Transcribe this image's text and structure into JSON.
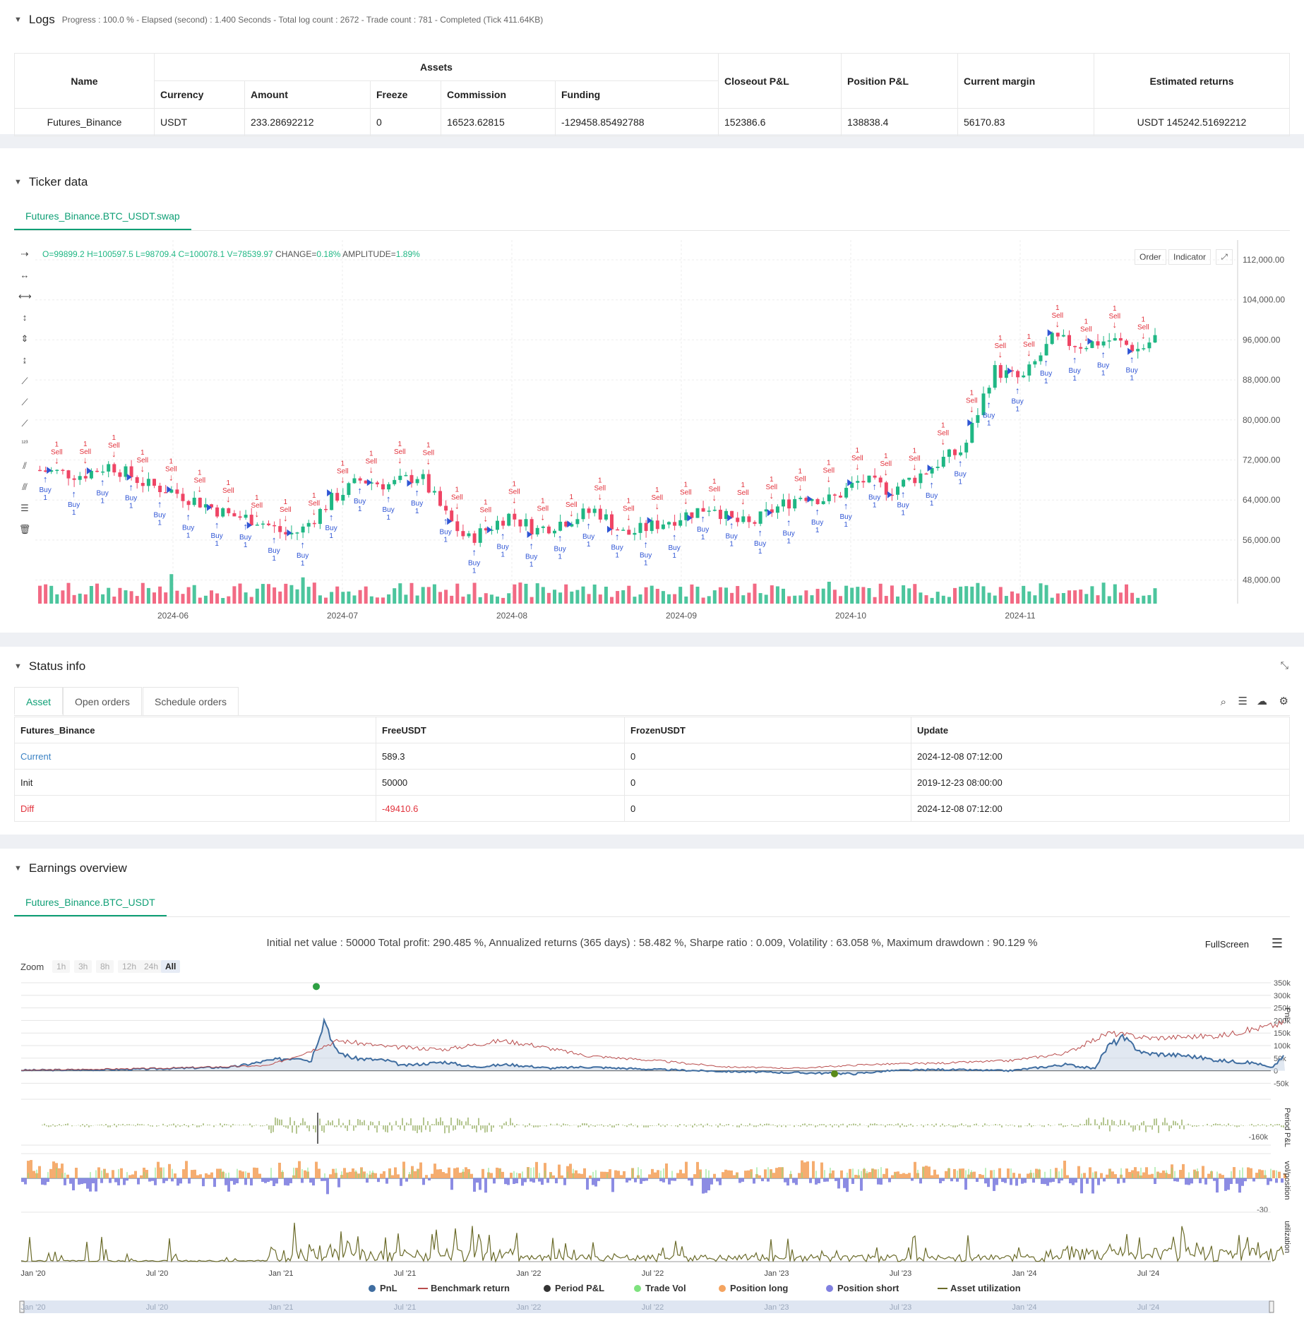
{
  "logs": {
    "title": "Logs",
    "summary": "Progress : 100.0 % - Elapsed (second) : 1.400 Seconds - Total log count : 2672 - Trade count : 781 - Completed (Tick 411.64KB)"
  },
  "assets_table": {
    "h_name": "Name",
    "h_assets": "Assets",
    "h_currency": "Currency",
    "h_amount": "Amount",
    "h_freeze": "Freeze",
    "h_commission": "Commission",
    "h_funding": "Funding",
    "h_closeout": "Closeout P&L",
    "h_position": "Position P&L",
    "h_margin": "Current margin",
    "h_estimated": "Estimated returns",
    "row": {
      "name": "Futures_Binance",
      "currency": "USDT",
      "amount": "233.28692212",
      "freeze": "0",
      "commission": "16523.62815",
      "funding": "-129458.85492788",
      "closeout": "152386.6",
      "position": "138838.4",
      "margin": "56170.83",
      "estimated": "USDT 145242.51692212"
    }
  },
  "ticker": {
    "title": "Ticker data",
    "tab": "Futures_Binance.BTC_USDT.swap",
    "ohlc": {
      "o": "O=99899.2",
      "h": "H=100597.5",
      "l": "L=98709.4",
      "c": "C=100078.1",
      "v": "V=78539.97",
      "change_label": "CHANGE=",
      "change": "0.18%",
      "amp_label": "AMPLITUDE=",
      "amp": "1.89%"
    },
    "order_btn": "Order",
    "indicator_btn": "Indicator",
    "y_ticks": [
      "112,000.00",
      "104,000.00",
      "96,000.00",
      "88,000.00",
      "80,000.00",
      "72,000.00",
      "64,000.00",
      "56,000.00",
      "48,000.00"
    ],
    "x_ticks": [
      "2024-06",
      "2024-07",
      "2024-08",
      "2024-09",
      "2024-10",
      "2024-11"
    ],
    "buy_label": "Buy",
    "sell_label": "Sell",
    "qty_label": "1",
    "colors": {
      "up": "#1fb784",
      "down": "#ef4565",
      "buy": "#2f55d4",
      "sell": "#e2333d"
    }
  },
  "status": {
    "title": "Status info",
    "tabs": [
      "Asset",
      "Open orders",
      "Schedule orders"
    ],
    "headers": [
      "Futures_Binance",
      "FreeUSDT",
      "FrozenUSDT",
      "Update"
    ],
    "rows": [
      {
        "label": "Current",
        "free": "589.3",
        "frozen": "0",
        "update": "2024-12-08 07:12:00"
      },
      {
        "label": "Init",
        "free": "50000",
        "frozen": "0",
        "update": "2019-12-23 08:00:00"
      },
      {
        "label": "Diff",
        "free": "-49410.6",
        "frozen": "0",
        "update": "2024-12-08 07:12:00"
      }
    ]
  },
  "earnings": {
    "title": "Earnings overview",
    "tab": "Futures_Binance.BTC_USDT",
    "summary": "Initial net value : 50000 Total profit: 290.485 %, Annualized returns (365 days) : 58.482 %, Sharpe ratio : 0.009, Volatility : 63.058 %, Maximum drawdown : 90.129 %",
    "fullscreen": "FullScreen",
    "zoom_label": "Zoom",
    "zoom_opts": [
      "1h",
      "3h",
      "8h",
      "12h",
      "24h",
      "All"
    ],
    "pnl_ticks": [
      "350k",
      "300k",
      "250k",
      "200k",
      "150k",
      "100k",
      "50k",
      "0",
      "-50k"
    ],
    "period_tick": "-160k",
    "vol_tick": "-30",
    "axis_titles": {
      "pnl": "PnL",
      "period": "Period P&L",
      "vol": "vol/position",
      "util": "utilization"
    },
    "x_ticks": [
      "Jan '20",
      "Jul '20",
      "Jan '21",
      "Jul '21",
      "Jan '22",
      "Jul '22",
      "Jan '23",
      "Jul '23",
      "Jan '24",
      "Jul '24"
    ],
    "legend": [
      {
        "name": "PnL",
        "color": "#3f6da0",
        "kind": "dot"
      },
      {
        "name": "Benchmark return",
        "color": "#b94d4d",
        "kind": "line"
      },
      {
        "name": "Period P&L",
        "color": "#333333",
        "kind": "dot"
      },
      {
        "name": "Trade Vol",
        "color": "#7ee27e",
        "kind": "dot"
      },
      {
        "name": "Position long",
        "color": "#f4a460",
        "kind": "dot"
      },
      {
        "name": "Position short",
        "color": "#8080e0",
        "kind": "dot"
      },
      {
        "name": "Asset utilization",
        "color": "#6b6b2a",
        "kind": "line"
      }
    ]
  }
}
